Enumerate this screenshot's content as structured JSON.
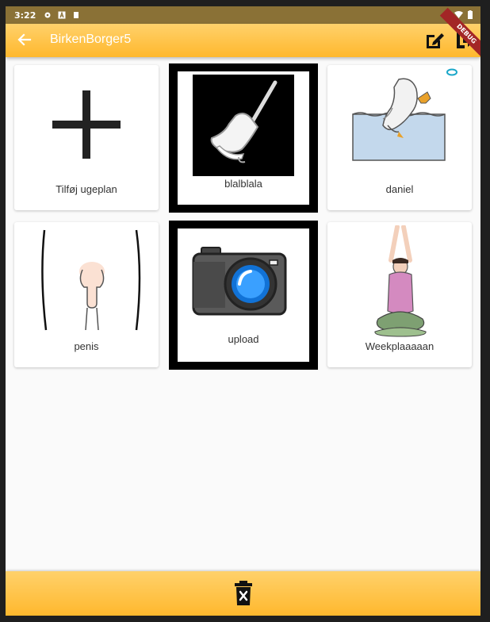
{
  "status_bar": {
    "time": "3:22"
  },
  "app_bar": {
    "title": "BirkenBorger5",
    "debug_banner": "DEBUG"
  },
  "grid": {
    "items": [
      {
        "label": "Tilføj ugeplan",
        "icon": "plus-icon",
        "selected": false
      },
      {
        "label": "blalblala",
        "icon": "bell-icon",
        "selected": true
      },
      {
        "label": "daniel",
        "icon": "diving-bird-image",
        "selected": false
      },
      {
        "label": "penis",
        "icon": "body-illustration",
        "selected": false
      },
      {
        "label": "upload",
        "icon": "camera-icon",
        "selected": true
      },
      {
        "label": "Weekplaaaaan",
        "icon": "yoga-pose-image",
        "selected": false
      }
    ]
  },
  "colors": {
    "accent": "#ffbd35",
    "status_bar": "#8a7136",
    "selected_border": "#000000"
  }
}
